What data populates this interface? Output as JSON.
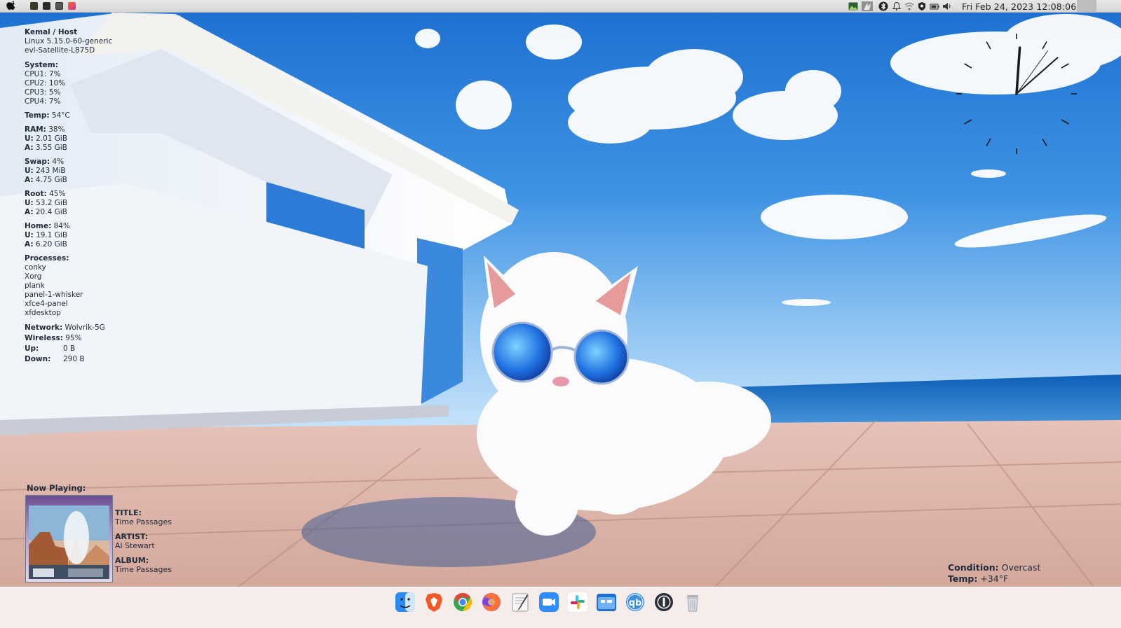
{
  "top_panel": {
    "datetime": "Fri Feb 24, 2023 12:08:06",
    "launchers": [
      {
        "name": "terminal-launcher",
        "color": "#3a3a2a"
      },
      {
        "name": "dark-app-launcher",
        "color": "#2b2b2b"
      },
      {
        "name": "settings-launcher",
        "color": "#444444"
      },
      {
        "name": "pink-app-launcher",
        "color": "#e0408a"
      }
    ],
    "tray_icons": [
      "image-viewer-icon",
      "bird-icon",
      "bluetooth-icon",
      "bell-icon",
      "wifi-icon",
      "shield-icon",
      "battery-icon",
      "volume-icon"
    ]
  },
  "sysinfo": {
    "user_host": "Kemal / Host",
    "kernel": "Linux 5.15.0-60-generic",
    "machine": "evl-Satellite-L875D",
    "system_label": "System:",
    "cpus": [
      "CPU1: 7%",
      "CPU2: 10%",
      "CPU3: 5%",
      "CPU4: 7%"
    ],
    "temp_label": "Temp:",
    "temp_value": "54°C",
    "ram_label": "RAM:",
    "ram_value": "38%",
    "ram_used_label": "U:",
    "ram_used": "2.01 GiB",
    "ram_avail_label": "A:",
    "ram_avail": "3.55 GiB",
    "swap_label": "Swap:",
    "swap_value": "4%",
    "swap_used_label": "U:",
    "swap_used": "243 MiB",
    "swap_avail_label": "A:",
    "swap_avail": "4.75 GiB",
    "root_label": "Root:",
    "root_value": "45%",
    "root_used_label": "U:",
    "root_used": "53.2 GiB",
    "root_avail_label": "A:",
    "root_avail": "20.4 GiB",
    "home_label": "Home:",
    "home_value": "84%",
    "home_used_label": "U:",
    "home_used": "19.1 GiB",
    "home_avail_label": "A:",
    "home_avail": "6.20 GiB",
    "processes_label": "Processes:",
    "processes": [
      "conky",
      "Xorg",
      "plank",
      "panel-1-whisker",
      "xfce4-panel",
      "xfdesktop"
    ],
    "network_label": "Network:",
    "network_value": "Wolvrik-5G",
    "wireless_label": "Wireless:",
    "wireless_value": "95%",
    "up_label": "Up:",
    "up_value": "0 B",
    "down_label": "Down:",
    "down_value": "290 B"
  },
  "analog_clock": {
    "hour": 12,
    "minute": 8,
    "second": 6
  },
  "now_playing": {
    "heading": "Now Playing:",
    "title_label": "TITLE:",
    "title": "Time Passages",
    "artist_label": "ARTIST:",
    "artist": "Al Stewart",
    "album_label": "ALBUM:",
    "album": "Time Passages"
  },
  "weather": {
    "condition_label": "Condition:",
    "condition": "Overcast",
    "temp_label": "Temp:",
    "temp": "+34°F"
  },
  "dock": {
    "apps": [
      {
        "name": "finder-icon",
        "color": "#2a8bf2"
      },
      {
        "name": "brave-icon",
        "color": "#f15a24"
      },
      {
        "name": "chrome-icon",
        "color": "#34a853"
      },
      {
        "name": "firefox-icon",
        "color": "#ff7139"
      },
      {
        "name": "text-editor-icon",
        "color": "#f2f2f2"
      },
      {
        "name": "zoom-icon",
        "color": "#2d8cff"
      },
      {
        "name": "slack-icon",
        "color": "#ffffff"
      },
      {
        "name": "file-manager-icon",
        "color": "#1f6fd1"
      },
      {
        "name": "qbittorrent-icon",
        "color": "#3b8ee0"
      },
      {
        "name": "1password-icon",
        "color": "#2a2f3a"
      },
      {
        "name": "trash-icon",
        "color": "#cfd3d8"
      }
    ]
  }
}
